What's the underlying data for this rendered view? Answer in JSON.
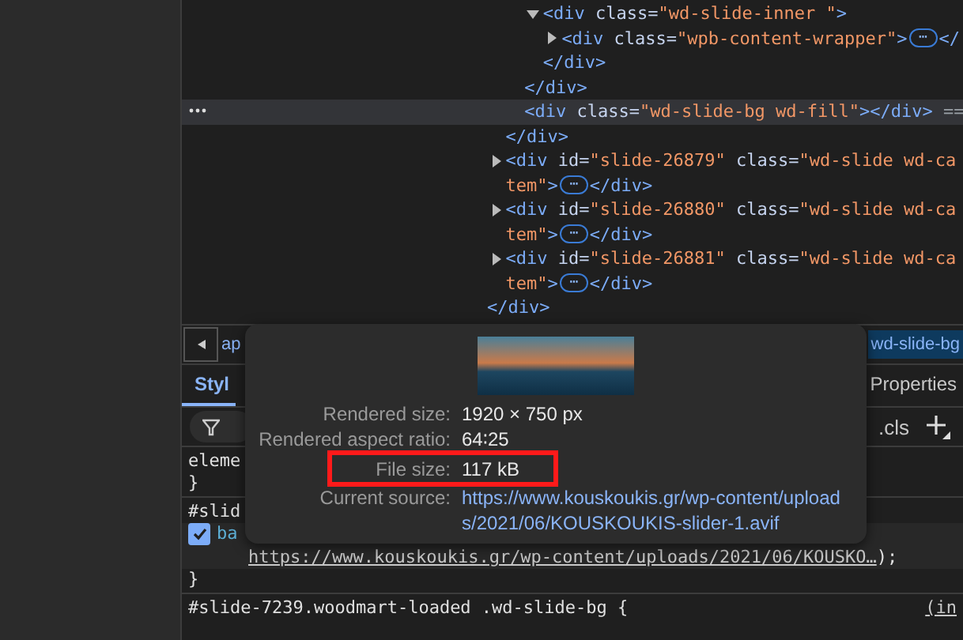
{
  "elements_tree": {
    "close": [
      {
        "kind": "tag",
        "text": "</div>"
      }
    ],
    "children": [
      {
        "close": [
          {
            "kind": "tag",
            "text": "</div>"
          }
        ],
        "children": [
          {
            "close": [
              {
                "kind": "tag",
                "text": "</div>"
              }
            ],
            "children": [
              {
                "expanded": true,
                "open": [
                  [
                    {
                      "kind": "tag",
                      "text": "<div"
                    },
                    {
                      "kind": "attr",
                      "text": " class="
                    },
                    {
                      "kind": "value",
                      "text": "\"wd-slide-inner \""
                    },
                    {
                      "kind": "tag",
                      "text": ">"
                    }
                  ]
                ],
                "close": [
                  {
                    "kind": "tag",
                    "text": "</div>"
                  }
                ],
                "children": [
                  {
                    "expanded": false,
                    "open": [
                      [
                        {
                          "kind": "tag",
                          "text": "<div"
                        },
                        {
                          "kind": "attr",
                          "text": " class="
                        },
                        {
                          "kind": "value",
                          "text": "\"wpb-content-wrapper\""
                        },
                        {
                          "kind": "tag",
                          "text": ">"
                        },
                        {
                          "kind": "ellipsis",
                          "text": "⋯"
                        },
                        {
                          "kind": "tag",
                          "text": "</"
                        }
                      ]
                    ]
                  }
                ]
              }
            ]
          },
          {
            "selected": true,
            "open": [
              [
                {
                  "kind": "tag",
                  "text": "<div"
                },
                {
                  "kind": "attr",
                  "text": " class="
                },
                {
                  "kind": "value",
                  "text": "\"wd-slide-bg wd-fill\""
                },
                {
                  "kind": "tag",
                  "text": "></div>"
                },
                {
                  "kind": "plain",
                  "text": " =="
                }
              ]
            ]
          }
        ]
      },
      {
        "expanded": false,
        "open": [
          [
            {
              "kind": "tag",
              "text": "<div"
            },
            {
              "kind": "attr",
              "text": " id="
            },
            {
              "kind": "value",
              "text": "\"slide-26879\""
            },
            {
              "kind": "attr",
              "text": " class="
            },
            {
              "kind": "value",
              "text": "\"wd-slide wd-ca"
            }
          ],
          [
            {
              "kind": "value",
              "text": "tem\""
            },
            {
              "kind": "tag",
              "text": ">"
            },
            {
              "kind": "ellipsis",
              "text": "⋯"
            },
            {
              "kind": "tag",
              "text": "</div>"
            }
          ]
        ]
      },
      {
        "expanded": false,
        "open": [
          [
            {
              "kind": "tag",
              "text": "<div"
            },
            {
              "kind": "attr",
              "text": " id="
            },
            {
              "kind": "value",
              "text": "\"slide-26880\""
            },
            {
              "kind": "attr",
              "text": " class="
            },
            {
              "kind": "value",
              "text": "\"wd-slide wd-ca"
            }
          ],
          [
            {
              "kind": "value",
              "text": "tem\""
            },
            {
              "kind": "tag",
              "text": ">"
            },
            {
              "kind": "ellipsis",
              "text": "⋯"
            },
            {
              "kind": "tag",
              "text": "</div>"
            }
          ]
        ]
      },
      {
        "expanded": false,
        "open": [
          [
            {
              "kind": "tag",
              "text": "<div"
            },
            {
              "kind": "attr",
              "text": " id="
            },
            {
              "kind": "value",
              "text": "\"slide-26881\""
            },
            {
              "kind": "attr",
              "text": " class="
            },
            {
              "kind": "value",
              "text": "\"wd-slide wd-ca"
            }
          ],
          [
            {
              "kind": "value",
              "text": "tem\""
            },
            {
              "kind": "tag",
              "text": ">"
            },
            {
              "kind": "ellipsis",
              "text": "⋯"
            },
            {
              "kind": "tag",
              "text": "</div>"
            }
          ]
        ]
      }
    ]
  },
  "breadcrumbs": [
    {
      "label": "ap",
      "selected": false
    },
    {
      "label": "wd-slide-bg",
      "selected": true
    }
  ],
  "tabs": [
    {
      "label": "Styl",
      "selected": true
    },
    {
      "label": "Properties",
      "selected": false
    }
  ],
  "filter_bar": {
    "cls_button": ".cls"
  },
  "style_rules": [
    {
      "selector": "eleme",
      "close": "}"
    },
    {
      "selector": "#slid",
      "declarations": [
        {
          "enabled": true,
          "property": "ba",
          "link": "https://www.kouskoukis.gr/wp-content/uploads/2021/06/KOUSKO…",
          "suffix": " );"
        }
      ],
      "close": "}"
    },
    {
      "selector": "#slide-7239.woodmart-loaded .wd-slide-bg {",
      "source": "(in"
    }
  ],
  "image_tooltip": {
    "rows": [
      {
        "kind": "text",
        "label": "Rendered size:",
        "value": "1920 × 750 px",
        "highlighted": false
      },
      {
        "kind": "text",
        "label": "Rendered aspect ratio:",
        "value": "64∶25",
        "highlighted": false
      },
      {
        "kind": "text",
        "label": "File size:",
        "value": "117 kB",
        "highlighted": true
      },
      {
        "kind": "link",
        "label": "Current source:",
        "value": "https://www.kouskoukis.gr/wp-content/uploads/2021/06/KOUSKOUKIS-slider-1.avif",
        "highlighted": false
      }
    ]
  }
}
